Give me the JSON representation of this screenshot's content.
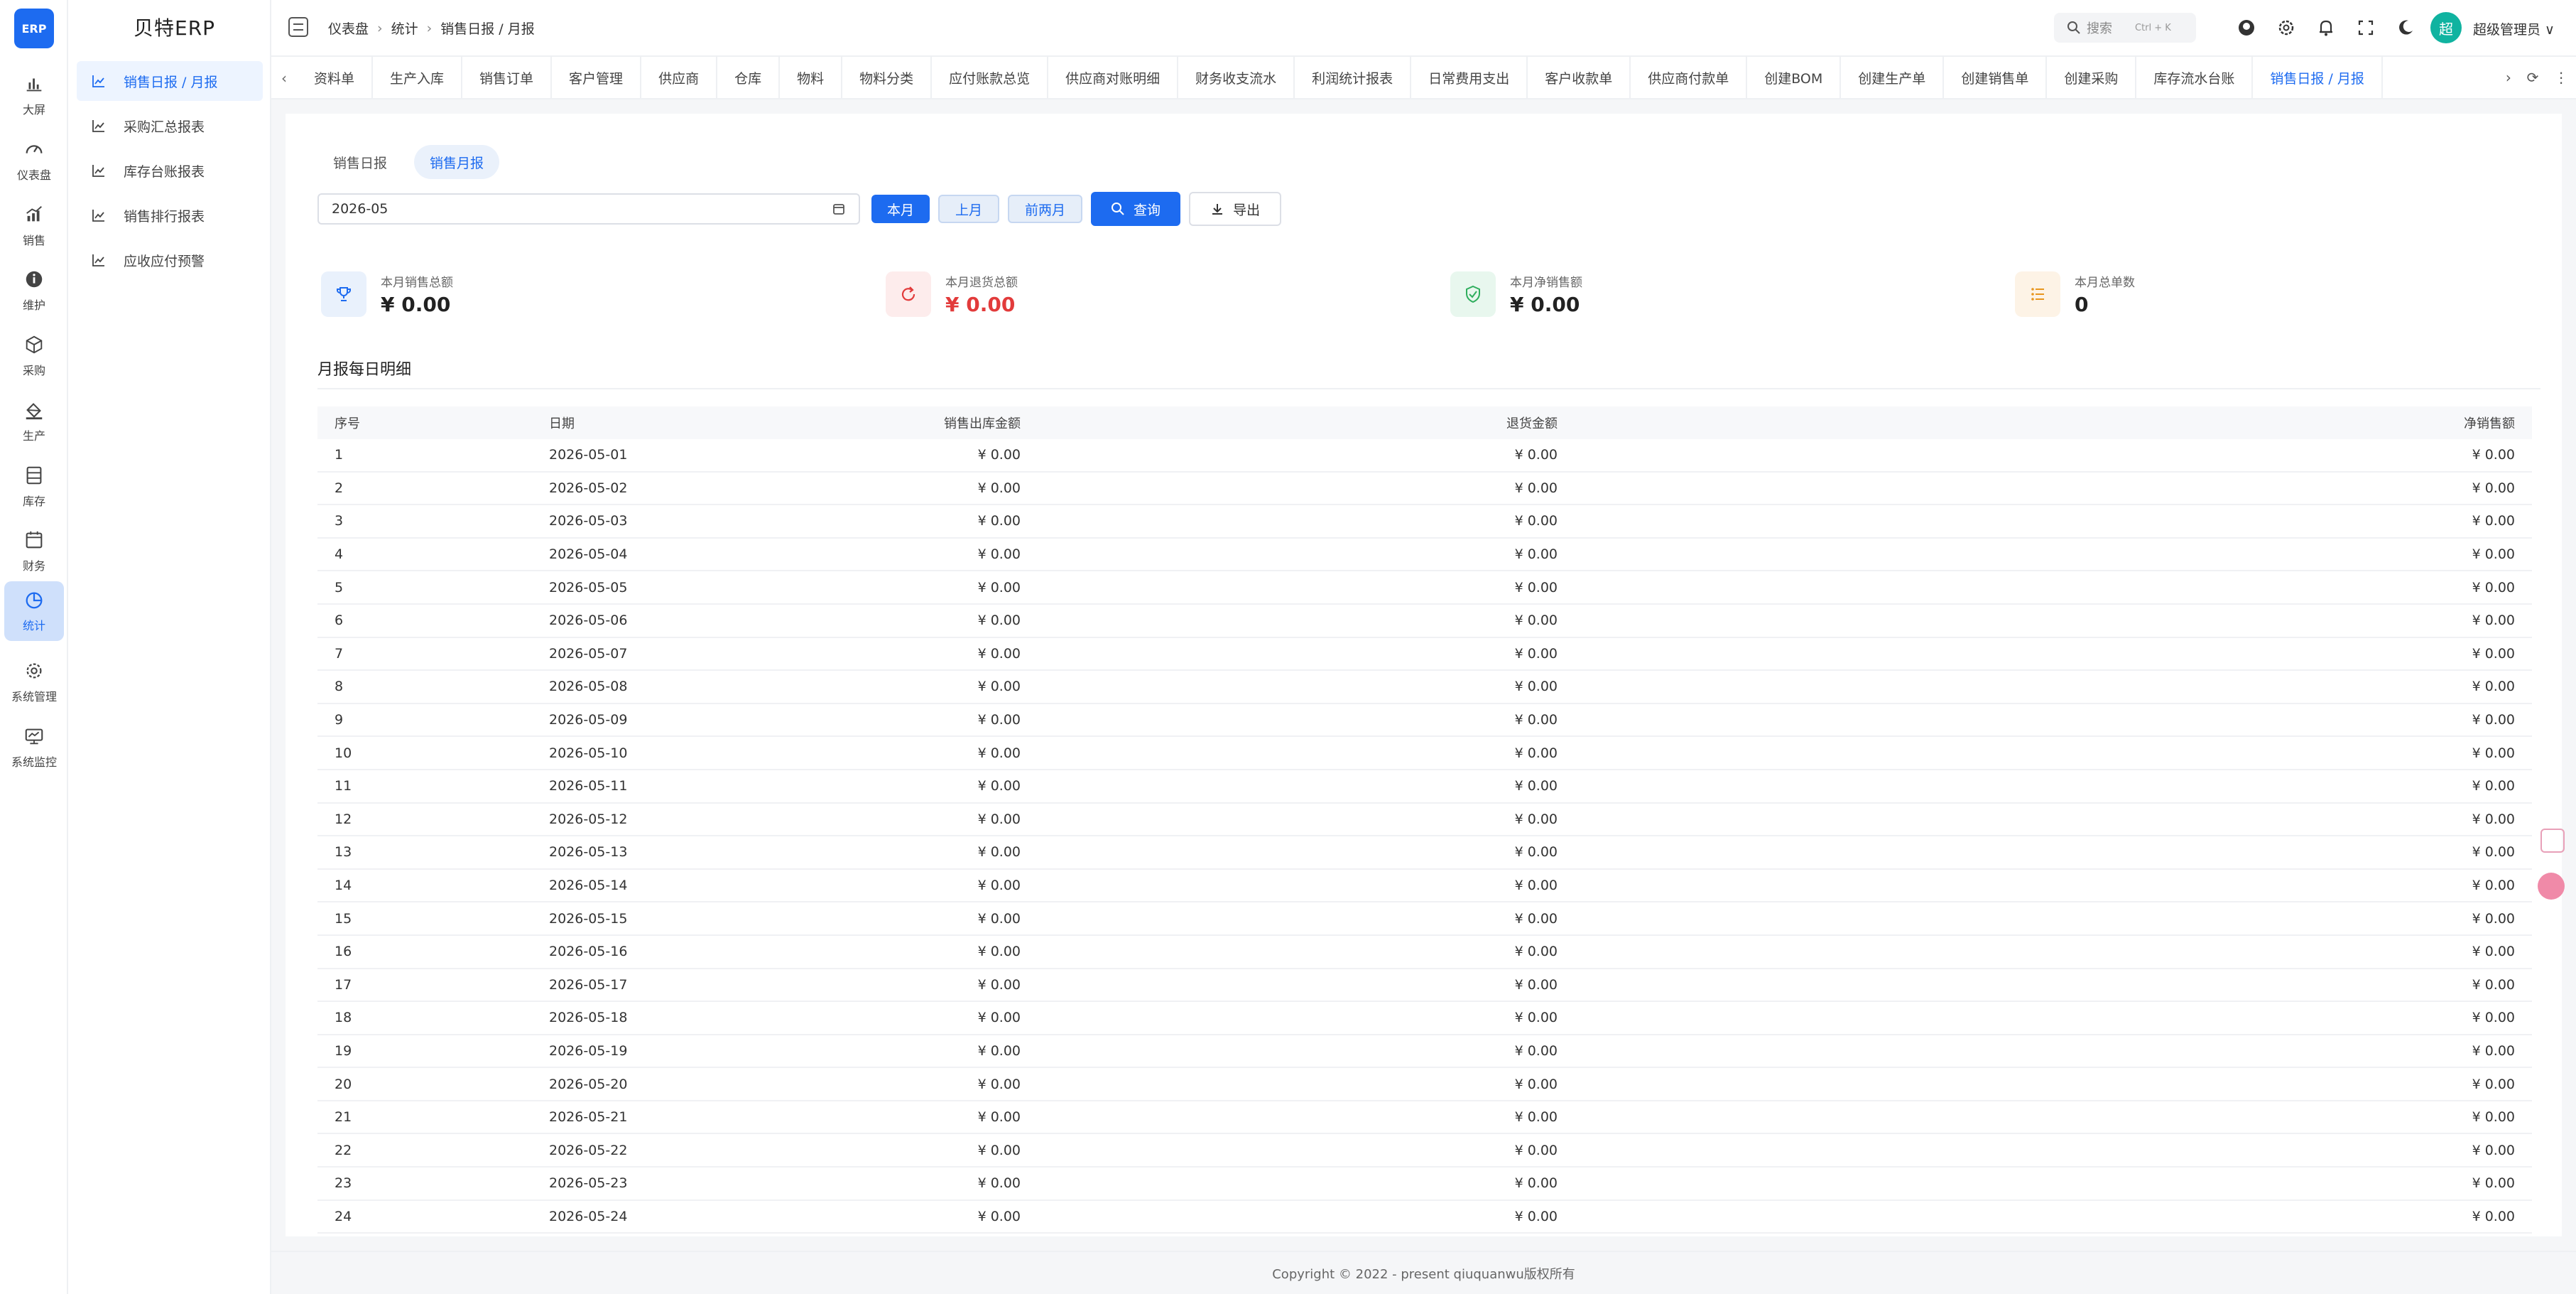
{
  "app": {
    "logo": "ERP",
    "brand": "贝特ERP"
  },
  "rail": [
    {
      "label": "大屏",
      "icon": "bar-chart-icon"
    },
    {
      "label": "仪表盘",
      "icon": "gauge-icon"
    },
    {
      "label": "销售",
      "icon": "trend-chart-icon"
    },
    {
      "label": "维护",
      "icon": "info-icon"
    },
    {
      "label": "采购",
      "icon": "box-icon"
    },
    {
      "label": "生产",
      "icon": "paint-bucket-icon"
    },
    {
      "label": "库存",
      "icon": "storage-icon"
    },
    {
      "label": "财务",
      "icon": "calendar-icon"
    },
    {
      "label": "统计",
      "icon": "pie-chart-icon",
      "active": true
    },
    {
      "label": "系统管理",
      "icon": "gear-icon"
    },
    {
      "label": "系统监控",
      "icon": "monitor-icon"
    }
  ],
  "submenu": [
    {
      "label": "销售日报 / 月报",
      "active": true
    },
    {
      "label": "采购汇总报表"
    },
    {
      "label": "库存台账报表"
    },
    {
      "label": "销售排行报表"
    },
    {
      "label": "应收应付预警"
    }
  ],
  "header": {
    "breadcrumb": [
      "仪表盘",
      "统计",
      "销售日报 / 月报"
    ],
    "search_label": "搜索",
    "search_shortcut": "Ctrl + K",
    "avatar_text": "超",
    "username": "超级管理员 ∨"
  },
  "tabs": [
    {
      "label": "资料单"
    },
    {
      "label": "生产入库"
    },
    {
      "label": "销售订单"
    },
    {
      "label": "客户管理"
    },
    {
      "label": "供应商"
    },
    {
      "label": "仓库"
    },
    {
      "label": "物料"
    },
    {
      "label": "物料分类"
    },
    {
      "label": "应付账款总览"
    },
    {
      "label": "供应商对账明细"
    },
    {
      "label": "财务收支流水"
    },
    {
      "label": "利润统计报表"
    },
    {
      "label": "日常费用支出"
    },
    {
      "label": "客户收款单"
    },
    {
      "label": "供应商付款单"
    },
    {
      "label": "创建BOM"
    },
    {
      "label": "创建生产单"
    },
    {
      "label": "创建销售单"
    },
    {
      "label": "创建采购"
    },
    {
      "label": "库存流水台账"
    },
    {
      "label": "销售日报 / 月报",
      "active": true
    }
  ],
  "segments": [
    {
      "label": "销售日报"
    },
    {
      "label": "销售月报",
      "active": true
    }
  ],
  "filters": {
    "month_value": "2026-05",
    "btn_this_month": "本月",
    "btn_last_month": "上月",
    "btn_prev_two": "前两月",
    "btn_query": "查询",
    "btn_export": "导出"
  },
  "stats": [
    {
      "label": "本月销售总额",
      "value": "¥ 0.00",
      "icon": "trophy-icon",
      "bg": "#e9f1fc",
      "color": "#1d6bf0"
    },
    {
      "label": "本月退货总额",
      "value": "¥ 0.00",
      "icon": "refresh-icon",
      "bg": "#fdecec",
      "color": "#e23b3b",
      "red": true
    },
    {
      "label": "本月净销售额",
      "value": "¥ 0.00",
      "icon": "shield-check-icon",
      "bg": "#e8f7ee",
      "color": "#2fae5d"
    },
    {
      "label": "本月总单数",
      "value": "0",
      "icon": "list-icon",
      "bg": "#fdf3e6",
      "color": "#e8961f"
    }
  ],
  "section_title": "月报每日明细",
  "table": {
    "headers": [
      "序号",
      "日期",
      "销售出库金额",
      "退货金额",
      "净销售额"
    ],
    "rows": [
      [
        "1",
        "2026-05-01",
        "¥ 0.00",
        "¥ 0.00",
        "¥ 0.00"
      ],
      [
        "2",
        "2026-05-02",
        "¥ 0.00",
        "¥ 0.00",
        "¥ 0.00"
      ],
      [
        "3",
        "2026-05-03",
        "¥ 0.00",
        "¥ 0.00",
        "¥ 0.00"
      ],
      [
        "4",
        "2026-05-04",
        "¥ 0.00",
        "¥ 0.00",
        "¥ 0.00"
      ],
      [
        "5",
        "2026-05-05",
        "¥ 0.00",
        "¥ 0.00",
        "¥ 0.00"
      ],
      [
        "6",
        "2026-05-06",
        "¥ 0.00",
        "¥ 0.00",
        "¥ 0.00"
      ],
      [
        "7",
        "2026-05-07",
        "¥ 0.00",
        "¥ 0.00",
        "¥ 0.00"
      ],
      [
        "8",
        "2026-05-08",
        "¥ 0.00",
        "¥ 0.00",
        "¥ 0.00"
      ],
      [
        "9",
        "2026-05-09",
        "¥ 0.00",
        "¥ 0.00",
        "¥ 0.00"
      ],
      [
        "10",
        "2026-05-10",
        "¥ 0.00",
        "¥ 0.00",
        "¥ 0.00"
      ],
      [
        "11",
        "2026-05-11",
        "¥ 0.00",
        "¥ 0.00",
        "¥ 0.00"
      ],
      [
        "12",
        "2026-05-12",
        "¥ 0.00",
        "¥ 0.00",
        "¥ 0.00"
      ],
      [
        "13",
        "2026-05-13",
        "¥ 0.00",
        "¥ 0.00",
        "¥ 0.00"
      ],
      [
        "14",
        "2026-05-14",
        "¥ 0.00",
        "¥ 0.00",
        "¥ 0.00"
      ],
      [
        "15",
        "2026-05-15",
        "¥ 0.00",
        "¥ 0.00",
        "¥ 0.00"
      ],
      [
        "16",
        "2026-05-16",
        "¥ 0.00",
        "¥ 0.00",
        "¥ 0.00"
      ],
      [
        "17",
        "2026-05-17",
        "¥ 0.00",
        "¥ 0.00",
        "¥ 0.00"
      ],
      [
        "18",
        "2026-05-18",
        "¥ 0.00",
        "¥ 0.00",
        "¥ 0.00"
      ],
      [
        "19",
        "2026-05-19",
        "¥ 0.00",
        "¥ 0.00",
        "¥ 0.00"
      ],
      [
        "20",
        "2026-05-20",
        "¥ 0.00",
        "¥ 0.00",
        "¥ 0.00"
      ],
      [
        "21",
        "2026-05-21",
        "¥ 0.00",
        "¥ 0.00",
        "¥ 0.00"
      ],
      [
        "22",
        "2026-05-22",
        "¥ 0.00",
        "¥ 0.00",
        "¥ 0.00"
      ],
      [
        "23",
        "2026-05-23",
        "¥ 0.00",
        "¥ 0.00",
        "¥ 0.00"
      ],
      [
        "24",
        "2026-05-24",
        "¥ 0.00",
        "¥ 0.00",
        "¥ 0.00"
      ]
    ]
  },
  "footer": "Copyright © 2022 - present qiuquanwu版权所有"
}
